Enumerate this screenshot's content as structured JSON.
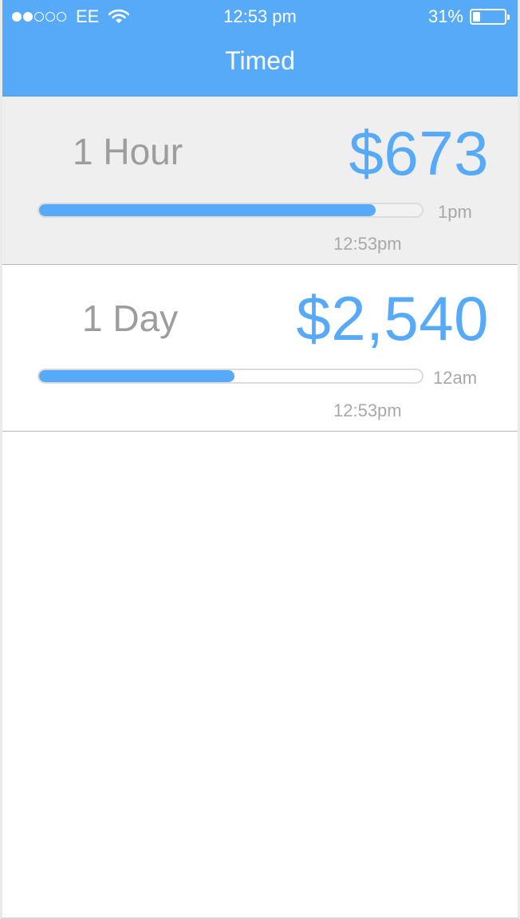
{
  "status_bar": {
    "signal_dots_filled": 2,
    "signal_dots_total": 5,
    "carrier": "EE",
    "time": "12:53 pm",
    "battery_percent_label": "31%",
    "battery_level": 0.31
  },
  "nav": {
    "title": "Timed"
  },
  "timers": [
    {
      "period": "1 Hour",
      "amount": "$673",
      "progress": 0.88,
      "end_label": "1pm",
      "current_time": "12:53pm"
    },
    {
      "period": "1 Day",
      "amount": "$2,540",
      "progress": 0.51,
      "end_label": "12am",
      "current_time": "12:53pm"
    }
  ],
  "colors": {
    "accent": "#56aaf7",
    "muted_text": "#9d9d9d",
    "selected_row_bg": "#efefef"
  }
}
